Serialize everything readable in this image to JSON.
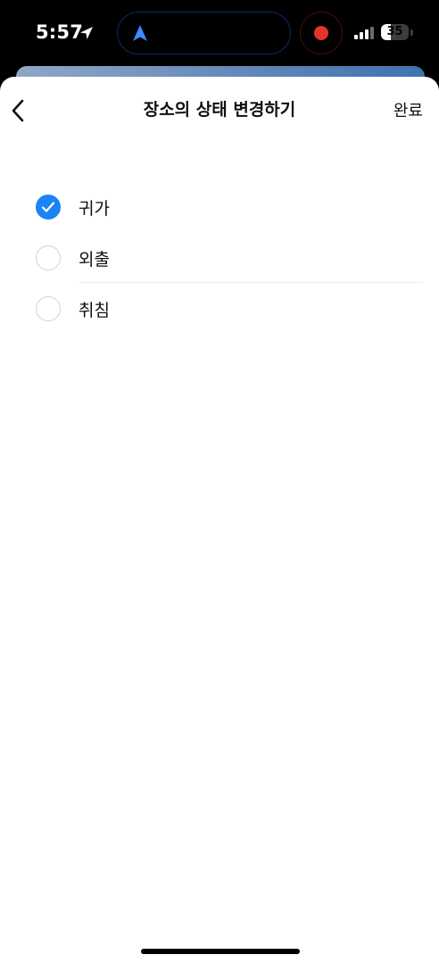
{
  "status_bar": {
    "time": "5:57",
    "battery_level": "35",
    "battery_percent": 35,
    "location_icon": "location-arrow-icon",
    "navigation_icon": "navigation-arrow-icon",
    "recording_icon": "record-dot-icon",
    "signal_icon": "cellular-signal-icon",
    "record_color": "#e5352b",
    "nav_color": "#3b8cff"
  },
  "header": {
    "title": "장소의 상태 변경하기",
    "back_icon": "chevron-left-icon",
    "done_label": "완료"
  },
  "options": [
    {
      "label": "귀가",
      "selected": true
    },
    {
      "label": "외출",
      "selected": false
    },
    {
      "label": "취침",
      "selected": false
    }
  ],
  "colors": {
    "accent": "#1a84f5",
    "text": "#111111",
    "radio_border": "#d2d2d2"
  }
}
